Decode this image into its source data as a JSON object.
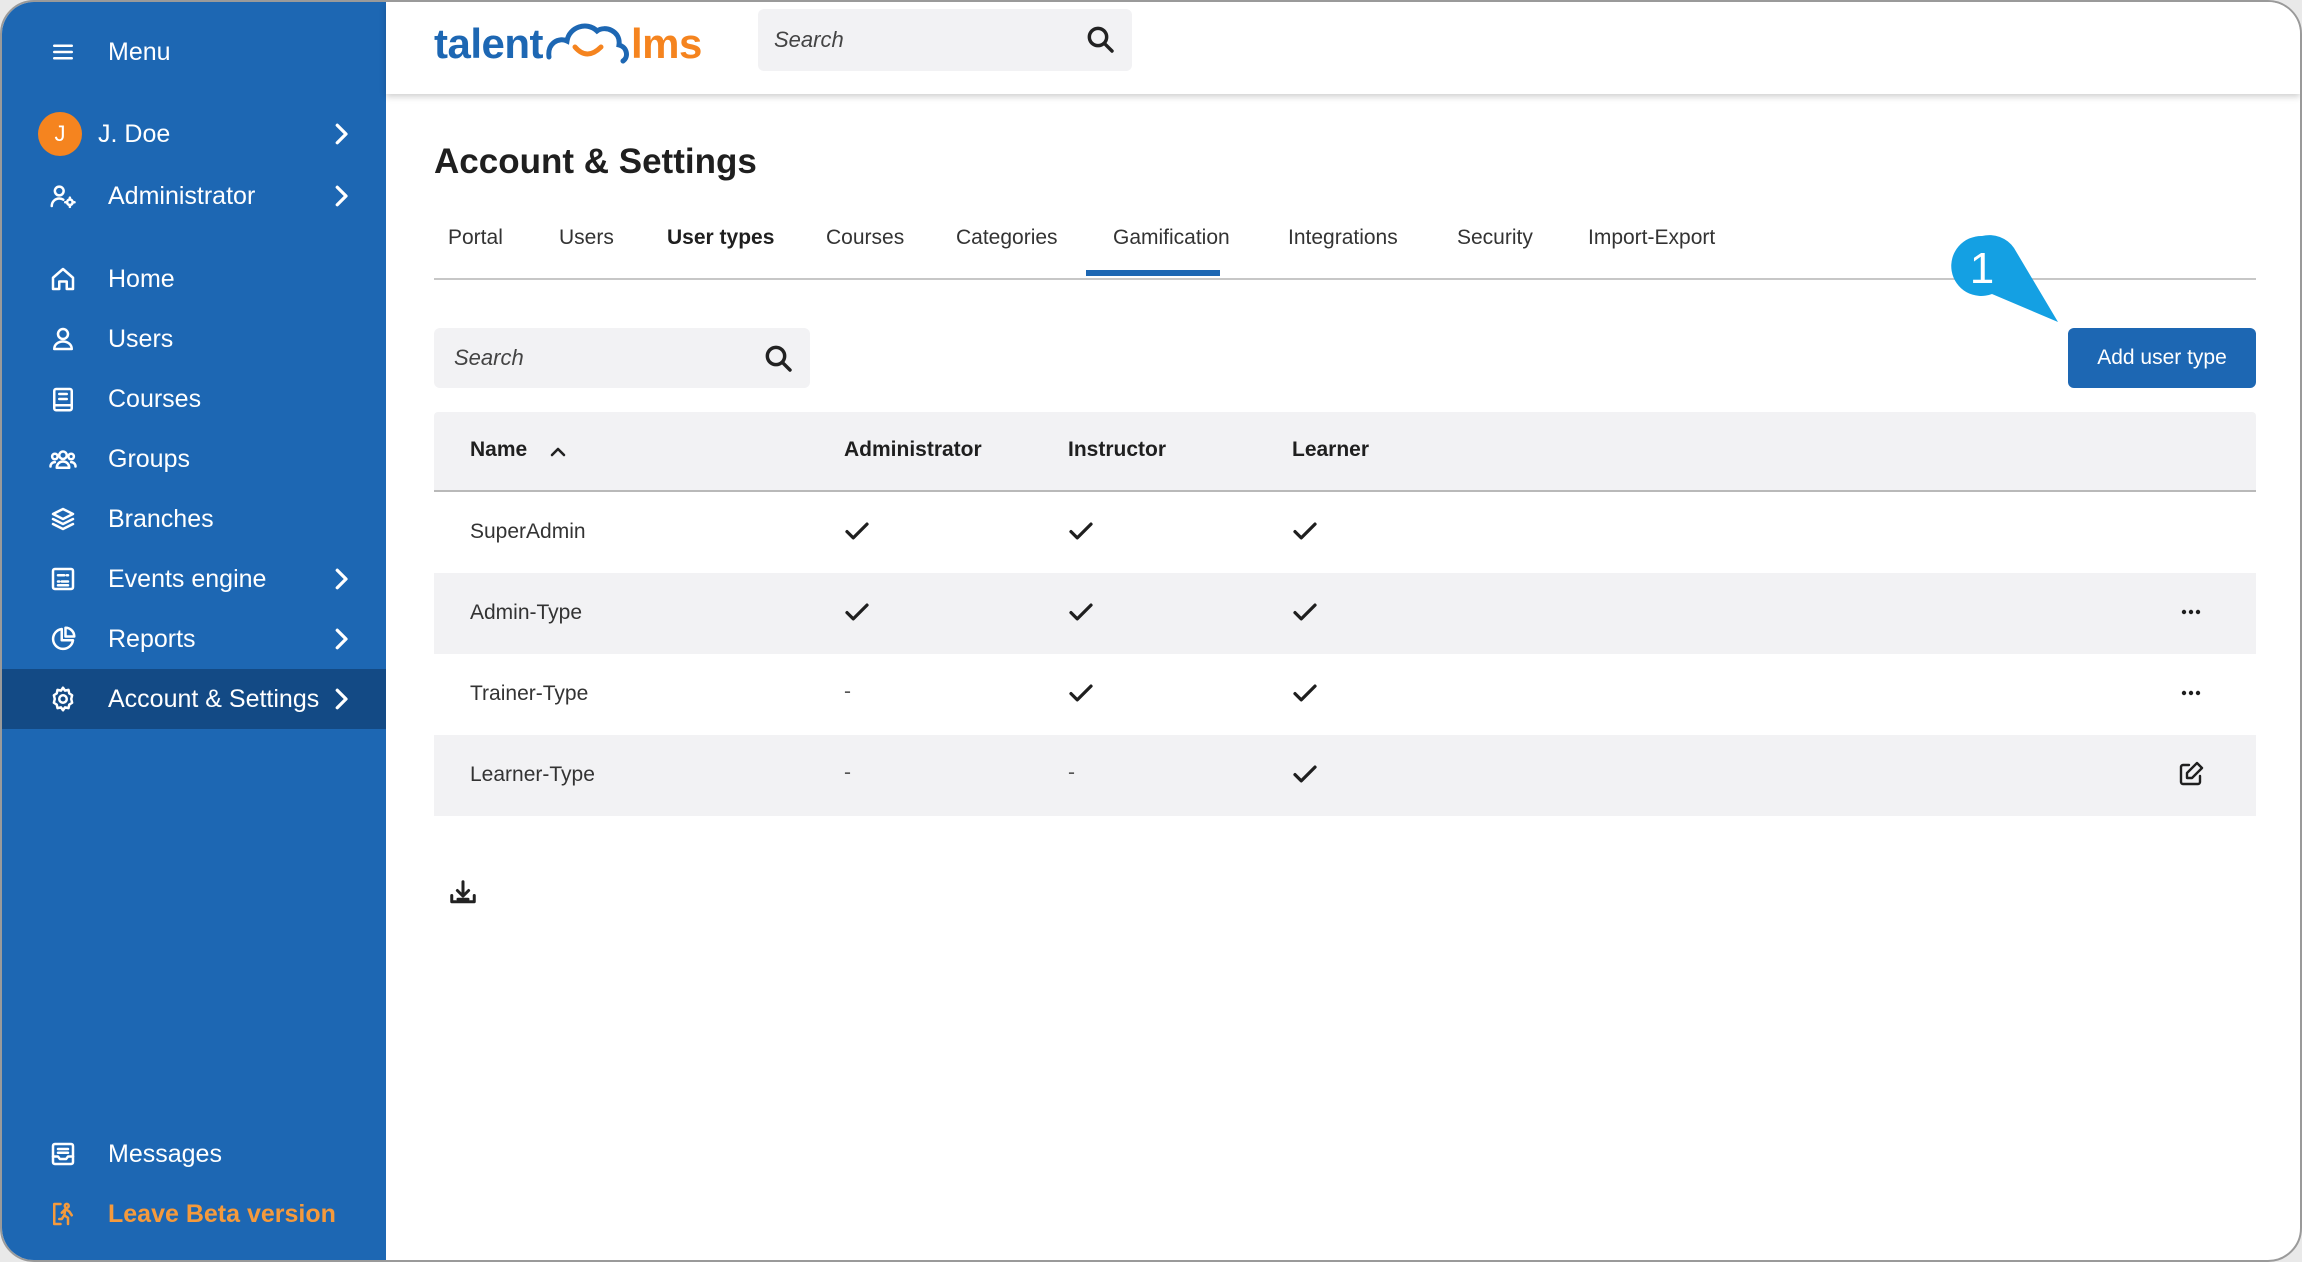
{
  "sidebar": {
    "menu_label": "Menu",
    "user": {
      "initial": "J",
      "name": "J. Doe"
    },
    "role_label": "Administrator",
    "items": [
      {
        "label": "Home",
        "icon": "home-icon"
      },
      {
        "label": "Users",
        "icon": "user-icon"
      },
      {
        "label": "Courses",
        "icon": "book-icon"
      },
      {
        "label": "Groups",
        "icon": "groups-icon"
      },
      {
        "label": "Branches",
        "icon": "layers-icon"
      },
      {
        "label": "Events engine",
        "icon": "events-icon"
      },
      {
        "label": "Reports",
        "icon": "pie-chart-icon"
      },
      {
        "label": "Account & Settings",
        "icon": "gear-icon"
      }
    ],
    "bottom": [
      {
        "label": "Messages",
        "icon": "inbox-icon"
      },
      {
        "label": "Leave Beta version",
        "icon": "exit-run-icon"
      }
    ],
    "colors": {
      "background": "#1d67b3",
      "active": "#134a85",
      "beta": "#f59a3c"
    }
  },
  "header": {
    "logo_left": "talent",
    "logo_right": "lms",
    "search_placeholder": "Search"
  },
  "main": {
    "title": "Account & Settings",
    "tabs": [
      "Portal",
      "Users",
      "User types",
      "Courses",
      "Categories",
      "Gamification",
      "Integrations",
      "Security",
      "Import-Export"
    ],
    "active_tab": "User types",
    "search_placeholder": "Search",
    "add_button": "Add user type",
    "callout_number": "1",
    "table": {
      "columns": [
        "Name",
        "Administrator",
        "Instructor",
        "Learner"
      ],
      "sort": "Name ascending",
      "rows": [
        {
          "name": "SuperAdmin",
          "administrator": "check",
          "instructor": "check",
          "learner": "check",
          "action": ""
        },
        {
          "name": "Admin-Type",
          "administrator": "check",
          "instructor": "check",
          "learner": "check",
          "action": "more-icon"
        },
        {
          "name": "Trainer-Type",
          "administrator": "-",
          "instructor": "check",
          "learner": "check",
          "action": "more-icon"
        },
        {
          "name": "Learner-Type",
          "administrator": "-",
          "instructor": "-",
          "learner": "check",
          "action": "edit-icon"
        }
      ]
    },
    "accent": "#1d67b3",
    "callout_color": "#14a0e3"
  }
}
